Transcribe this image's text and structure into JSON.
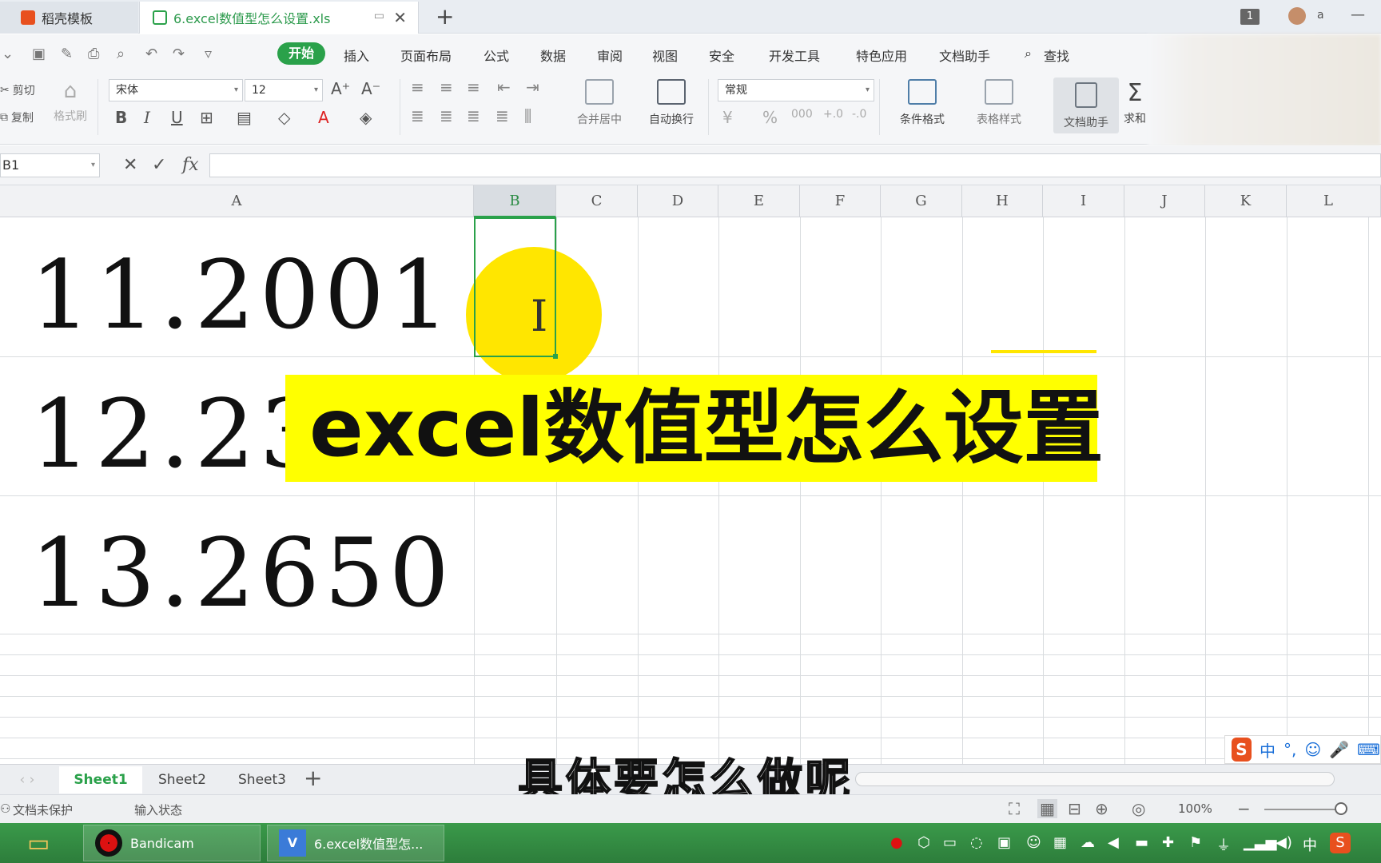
{
  "titlebar": {
    "tab_inactive": "稻壳模板",
    "tab_active": "6.excel数值型怎么设置.xls",
    "new_tab": "+",
    "window_badge": "1",
    "user_name": "a"
  },
  "menubar": {
    "start": "开始",
    "items": [
      "插入",
      "页面布局",
      "公式",
      "数据",
      "审阅",
      "视图",
      "安全",
      "开发工具",
      "特色应用",
      "文档助手",
      "查找"
    ]
  },
  "ribbon": {
    "cut": "剪切",
    "copy": "复制",
    "format_painter": "格式刷",
    "font_name": "宋体",
    "font_size": "12",
    "merge_center": "合并居中",
    "wrap_text": "自动换行",
    "number_format": "常规",
    "conditional_format": "条件格式",
    "table_style": "表格样式",
    "doc_helper": "文档助手",
    "sum": "求和"
  },
  "formulabar": {
    "name_box": "B1",
    "fx": "fx"
  },
  "columns": [
    "A",
    "B",
    "C",
    "D",
    "E",
    "F",
    "G",
    "H",
    "I",
    "J",
    "K",
    "L"
  ],
  "cells": {
    "a1": "11.2001",
    "a2": "12.23",
    "a3": "13.2650"
  },
  "banner": {
    "text": "excel数值型怎么设置"
  },
  "sheets": [
    "Sheet1",
    "Sheet2",
    "Sheet3"
  ],
  "subtitle": "具体要怎么做呢",
  "statusbar": {
    "protection": "文档未保护",
    "input_state": "输入状态",
    "zoom": "100%"
  },
  "taskbar": {
    "bandicam": "Bandicam",
    "excel_window": "6.excel数值型怎..."
  },
  "ime": {
    "mode": "中"
  },
  "colors": {
    "accent_green": "#2aa14a",
    "highlight_yellow": "#ffff00"
  }
}
